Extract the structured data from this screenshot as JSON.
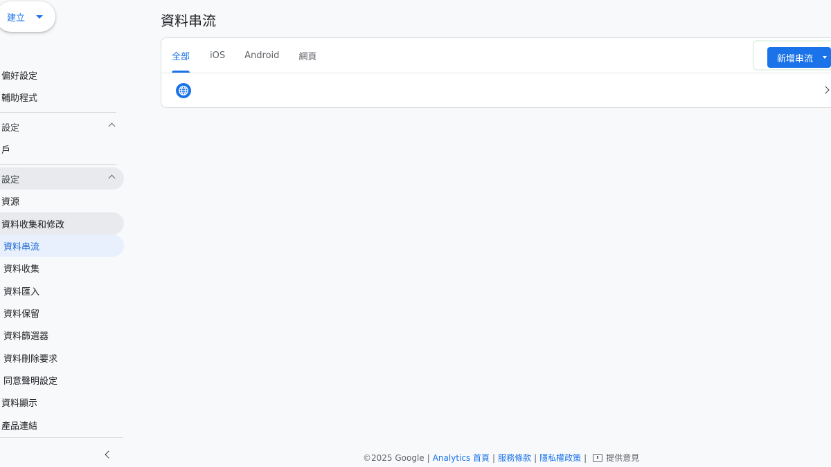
{
  "sidebar": {
    "create_label": "建立",
    "items": [
      {
        "label": ""
      },
      {
        "label": "偏好設定"
      },
      {
        "label": "輔助程式"
      },
      {
        "label": "設定"
      },
      {
        "label": "戶"
      },
      {
        "label": "設定"
      },
      {
        "label": "資源"
      },
      {
        "label": "資料收集和修改"
      },
      {
        "label": "資料串流"
      },
      {
        "label": "資料收集"
      },
      {
        "label": "資料匯入"
      },
      {
        "label": "資料保留"
      },
      {
        "label": "資料篩選器"
      },
      {
        "label": "資料刪除要求"
      },
      {
        "label": "同意聲明設定"
      },
      {
        "label": "資料顯示"
      },
      {
        "label": "產品連結"
      }
    ]
  },
  "main": {
    "title": "資料串流",
    "tabs": [
      {
        "label": "全部"
      },
      {
        "label": "iOS"
      },
      {
        "label": "Android"
      },
      {
        "label": "網頁"
      }
    ],
    "add_stream_label": "新增串流"
  },
  "footer": {
    "copyright": "©2025 Google",
    "links": [
      "Analytics 首頁",
      "服務條款",
      "隱私權政策"
    ],
    "feedback": "提供意見"
  },
  "colors": {
    "accent": "#1a73e8",
    "selected_bg": "#e8f0fe",
    "background": "#f8f9fb"
  }
}
